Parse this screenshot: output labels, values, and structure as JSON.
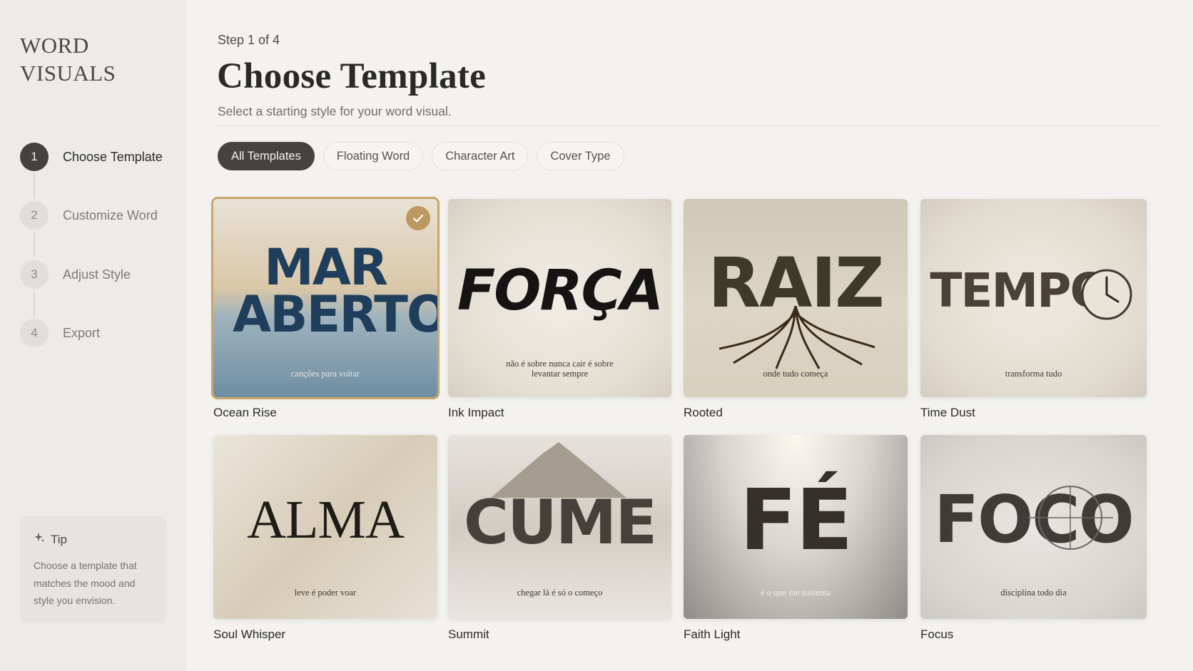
{
  "app": {
    "brand_line1": "WORD",
    "brand_line2": "VISUALS"
  },
  "steps": [
    {
      "num": "1",
      "label": "Choose Template",
      "active": true
    },
    {
      "num": "2",
      "label": "Customize Word",
      "active": false
    },
    {
      "num": "3",
      "label": "Adjust Style",
      "active": false
    },
    {
      "num": "4",
      "label": "Export",
      "active": false
    }
  ],
  "tip": {
    "title": "Tip",
    "body": "Choose a template that matches the mood and style you envision.",
    "icon": "sparkle-icon"
  },
  "header": {
    "step_indicator": "Step 1 of 4",
    "title": "Choose Template",
    "subtitle": "Select a starting style for your word visual."
  },
  "filters": [
    {
      "label": "All Templates",
      "active": true
    },
    {
      "label": "Floating Word",
      "active": false
    },
    {
      "label": "Character Art",
      "active": false
    },
    {
      "label": "Cover Type",
      "active": false
    }
  ],
  "templates": [
    {
      "name": "Ocean Rise",
      "word": "MAR ABERTO",
      "tagline": "canções para voltar",
      "selected": true
    },
    {
      "name": "Ink Impact",
      "word": "FORÇA",
      "tagline": "não é sobre nunca cair é sobre levantar sempre",
      "selected": false
    },
    {
      "name": "Rooted",
      "word": "RAIZ",
      "tagline": "onde tudo começa",
      "selected": false
    },
    {
      "name": "Time Dust",
      "word": "TEMPO",
      "tagline": "transforma tudo",
      "selected": false
    },
    {
      "name": "Soul Whisper",
      "word": "ALMA",
      "tagline": "leve é poder voar",
      "selected": false
    },
    {
      "name": "Summit",
      "word": "CUME",
      "tagline": "chegar lá é só o começo",
      "selected": false
    },
    {
      "name": "Faith Light",
      "word": "FÉ",
      "tagline": "é o que me sustenta",
      "selected": false
    },
    {
      "name": "Focus",
      "word": "FOCO",
      "tagline": "disciplina todo dia",
      "selected": false
    }
  ],
  "colors": {
    "accent_gold": "#bb9960",
    "dark": "#45433f",
    "background": "#f3f2ef"
  }
}
